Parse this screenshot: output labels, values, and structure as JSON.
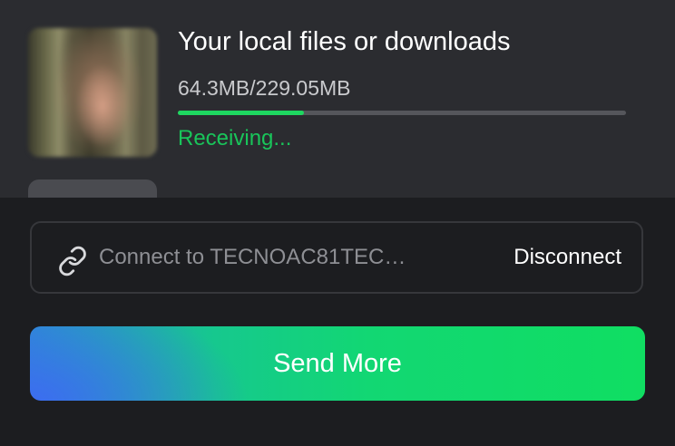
{
  "transfer": {
    "title": "Your local files or downloads",
    "size": "64.3MB/229.05MB",
    "progress": 0.281,
    "status": "Receiving..."
  },
  "connection": {
    "icon": "link-icon",
    "text": "Connect to TECNOAC81TECN…",
    "disconnect_label": "Disconnect"
  },
  "actions": {
    "send_more_label": "Send More"
  },
  "colors": {
    "accent_green": "#1ed760",
    "status_green": "#19c55a",
    "gradient_blue": "#3c6df0"
  }
}
